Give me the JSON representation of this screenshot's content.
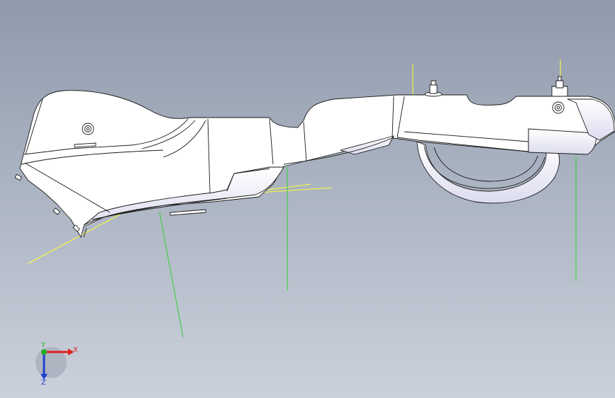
{
  "viewport": {
    "background_top": "#8f9aab",
    "background_bottom": "#cbd1dc"
  },
  "model": {
    "fill": "#ffffff",
    "edge_color": "#1a1a1a",
    "shade_color": "#d8d9ee"
  },
  "reference_lines": {
    "yellow": "#ffff33",
    "green": "#33cc33"
  },
  "triad": {
    "x_label": "X",
    "y_label": "Y",
    "z_label": "Z",
    "x_color": "#e02020",
    "y_color": "#20b020",
    "z_color": "#2040d0"
  }
}
